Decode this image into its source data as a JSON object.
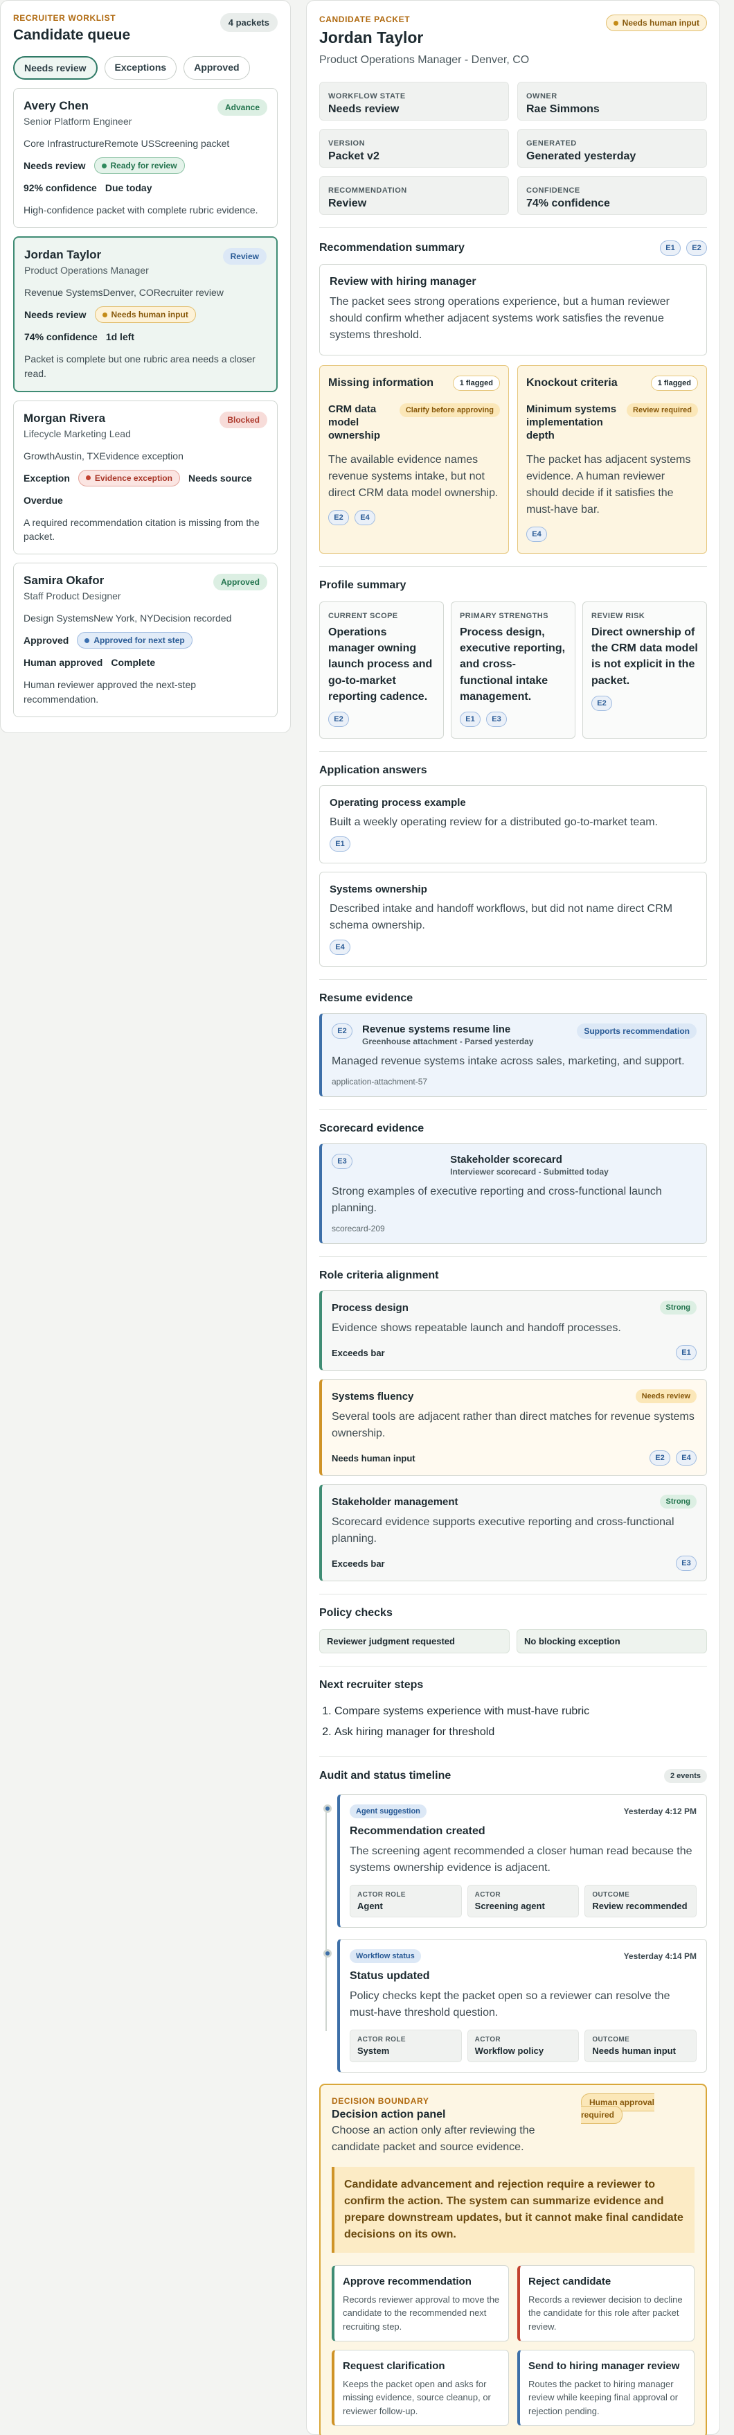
{
  "worklist": {
    "kicker": "RECRUITER WORKLIST",
    "title": "Candidate queue",
    "count": "4 packets",
    "tabs": [
      "Needs review",
      "Exceptions",
      "Approved"
    ],
    "candidates": [
      {
        "name": "Avery Chen",
        "role": "Senior Platform Engineer",
        "badge": "Advance",
        "meta": "Core InfrastructureRemote USScreening packet",
        "state": "Needs review",
        "chip": "Ready for review",
        "stat1": "92% confidence",
        "stat2": "Due today",
        "desc": "High-confidence packet with complete rubric evidence."
      },
      {
        "name": "Jordan Taylor",
        "role": "Product Operations Manager",
        "badge": "Review",
        "meta": "Revenue SystemsDenver, CORecruiter review",
        "state": "Needs review",
        "chip": "Needs human input",
        "stat1": "74% confidence",
        "stat2": "1d left",
        "desc": "Packet is complete but one rubric area needs a closer read."
      },
      {
        "name": "Morgan Rivera",
        "role": "Lifecycle Marketing Lead",
        "badge": "Blocked",
        "meta": "GrowthAustin, TXEvidence exception",
        "state": "Exception",
        "chip": "Evidence exception",
        "stat1": "Needs source",
        "stat2": "Overdue",
        "desc": "A required recommendation citation is missing from the packet."
      },
      {
        "name": "Samira Okafor",
        "role": "Staff Product Designer",
        "badge": "Approved",
        "meta": "Design SystemsNew York, NYDecision recorded",
        "state": "Approved",
        "chip": "Approved for next step",
        "stat1": "Human approved",
        "stat2": "Complete",
        "desc": "Human reviewer approved the next-step recommendation."
      }
    ]
  },
  "packet": {
    "kicker": "CANDIDATE PACKET",
    "name": "Jordan Taylor",
    "role": "Product Operations Manager - Denver, CO",
    "status": "Needs human input",
    "fields": [
      {
        "k": "WORKFLOW STATE",
        "v": "Needs review"
      },
      {
        "k": "OWNER",
        "v": "Rae Simmons"
      },
      {
        "k": "VERSION",
        "v": "Packet v2"
      },
      {
        "k": "GENERATED",
        "v": "Generated yesterday"
      },
      {
        "k": "RECOMMENDATION",
        "v": "Review"
      },
      {
        "k": "CONFIDENCE",
        "v": "74% confidence"
      }
    ]
  },
  "summary": {
    "title": "Recommendation summary",
    "refs": [
      "E1",
      "E2"
    ],
    "box_title": "Review with hiring manager",
    "box_body": "The packet sees strong operations experience, but a human reviewer should confirm whether adjacent systems work satisfies the revenue systems threshold.",
    "missing": {
      "head": "Missing information",
      "flag": "1 flagged",
      "item": "CRM data model ownership",
      "tag": "Clarify before approving",
      "body": "The available evidence names revenue systems intake, but not direct CRM data model ownership.",
      "refs": [
        "E2",
        "E4"
      ]
    },
    "knockout": {
      "head": "Knockout criteria",
      "flag": "1 flagged",
      "item": "Minimum systems implementation depth",
      "tag": "Review required",
      "body": "The packet has adjacent systems evidence. A human reviewer should decide if it satisfies the must-have bar.",
      "refs": [
        "E4"
      ]
    }
  },
  "profile": {
    "title": "Profile summary",
    "cols": [
      {
        "k": "CURRENT SCOPE",
        "v": "Operations manager owning launch process and go-to-market reporting cadence.",
        "refs": [
          "E2"
        ]
      },
      {
        "k": "PRIMARY STRENGTHS",
        "v": "Process design, executive reporting, and cross-functional intake management.",
        "refs": [
          "E1",
          "E3"
        ]
      },
      {
        "k": "REVIEW RISK",
        "v": "Direct ownership of the CRM data model is not explicit in the packet.",
        "refs": [
          "E2"
        ]
      }
    ]
  },
  "answers": {
    "title": "Application answers",
    "items": [
      {
        "t": "Operating process example",
        "b": "Built a weekly operating review for a distributed go-to-market team.",
        "ref": "E1"
      },
      {
        "t": "Systems ownership",
        "b": "Described intake and handoff workflows, but did not name direct CRM schema ownership.",
        "ref": "E4"
      }
    ]
  },
  "resume": {
    "title": "Resume evidence",
    "ref": "E2",
    "t1": "Revenue systems resume line",
    "t2": "Greenhouse attachment - Parsed yesterday",
    "sup": "Supports recommendation",
    "body": "Managed revenue systems intake across sales, marketing, and support.",
    "id": "application-attachment-57"
  },
  "scorecard": {
    "title": "Scorecard evidence",
    "ref": "E3",
    "t1": "Stakeholder scorecard",
    "t2": "Interviewer scorecard - Submitted today",
    "body": "Strong examples of executive reporting and cross-functional launch planning.",
    "id": "scorecard-209"
  },
  "criteria": {
    "title": "Role criteria alignment",
    "items": [
      {
        "t": "Process design",
        "tag": "Strong",
        "b": "Evidence shows repeatable launch and handoff processes.",
        "foot": "Exceeds bar",
        "refs": [
          "E1"
        ]
      },
      {
        "t": "Systems fluency",
        "tag": "Needs review",
        "b": "Several tools are adjacent rather than direct matches for revenue systems ownership.",
        "foot": "Needs human input",
        "refs": [
          "E2",
          "E4"
        ]
      },
      {
        "t": "Stakeholder management",
        "tag": "Strong",
        "b": "Scorecard evidence supports executive reporting and cross-functional planning.",
        "foot": "Exceeds bar",
        "refs": [
          "E3"
        ]
      }
    ]
  },
  "policy": {
    "title": "Policy checks",
    "items": [
      "Reviewer judgment requested",
      "No blocking exception"
    ]
  },
  "next": {
    "title": "Next recruiter steps",
    "items": [
      "Compare systems experience with must-have rubric",
      "Ask hiring manager for threshold"
    ]
  },
  "timeline": {
    "title": "Audit and status timeline",
    "count": "2 events",
    "events": [
      {
        "tag": "Agent suggestion",
        "time": "Yesterday 4:12 PM",
        "h": "Recommendation created",
        "b": "The screening agent recommended a closer human read because the systems ownership evidence is adjacent.",
        "cells": [
          {
            "k": "ACTOR ROLE",
            "v": "Agent"
          },
          {
            "k": "ACTOR",
            "v": "Screening agent"
          },
          {
            "k": "OUTCOME",
            "v": "Review recommended"
          }
        ]
      },
      {
        "tag": "Workflow status",
        "time": "Yesterday 4:14 PM",
        "h": "Status updated",
        "b": "Policy checks kept the packet open so a reviewer can resolve the must-have threshold question.",
        "cells": [
          {
            "k": "ACTOR ROLE",
            "v": "System"
          },
          {
            "k": "ACTOR",
            "v": "Workflow policy"
          },
          {
            "k": "OUTCOME",
            "v": "Needs human input"
          }
        ]
      }
    ]
  },
  "decision": {
    "kicker": "DECISION BOUNDARY",
    "title": "Decision action panel",
    "sub": "Choose an action only after reviewing the candidate packet and source evidence.",
    "req": "Human approval required",
    "warn": "Candidate advancement and rejection require a reviewer to confirm the action. The system can summarize evidence and prepare downstream updates, but it cannot make final candidate decisions on its own.",
    "actions": [
      {
        "t": "Approve recommendation",
        "d": "Records reviewer approval to move the candidate to the recommended next recruiting step."
      },
      {
        "t": "Reject candidate",
        "d": "Records a reviewer decision to decline the candidate for this role after packet review."
      },
      {
        "t": "Request clarification",
        "d": "Keeps the packet open and asks for missing evidence, source cleanup, or reviewer follow-up."
      },
      {
        "t": "Send to hiring manager review",
        "d": "Routes the packet to hiring manager review while keeping final approval or rejection pending."
      }
    ]
  },
  "colors": {
    "accent": "#2f7a66",
    "amber": "#cf9327",
    "blue": "#3d6fa8",
    "red": "#c2412f"
  }
}
